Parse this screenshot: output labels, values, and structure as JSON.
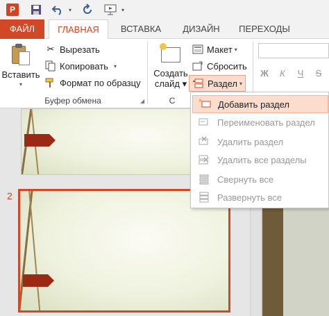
{
  "app": {
    "logo_text": "P",
    "accent_color": "#d24726",
    "icons": [
      "powerpoint-logo-icon",
      "save-icon",
      "undo-icon",
      "redo-icon",
      "slideshow-icon"
    ]
  },
  "tabs": [
    {
      "label": "ФАЙЛ"
    },
    {
      "label": "ГЛАВНАЯ",
      "selected": true
    },
    {
      "label": "ВСТАВКА"
    },
    {
      "label": "ДИЗАЙН"
    },
    {
      "label": "ПЕРЕХОДЫ"
    }
  ],
  "ribbon": {
    "clipboard": {
      "paste_label": "Вставить",
      "cut_label": "Вырезать",
      "copy_label": "Копировать",
      "format_painter_label": "Формат по образцу",
      "group_label": "Буфер обмена"
    },
    "slides": {
      "new_slide_line1": "Создать",
      "new_slide_line2": "слайд",
      "layout_label": "Макет",
      "reset_label": "Сбросить",
      "section_label": "Раздел",
      "group_label": "С"
    },
    "font": {
      "bold": "Ж",
      "italic": "К",
      "underline": "Ч",
      "strike": "S"
    }
  },
  "section_menu": {
    "items": [
      {
        "label": "Добавить раздел",
        "icon": "add-section-icon",
        "enabled": true,
        "highlighted": true
      },
      {
        "label": "Переименовать раздел",
        "icon": "rename-section-icon",
        "enabled": false
      },
      {
        "label": "Удалить раздел",
        "icon": "remove-section-icon",
        "enabled": false
      },
      {
        "label": "Удалить все разделы",
        "icon": "remove-all-sections-icon",
        "enabled": false
      },
      {
        "label": "Свернуть все",
        "icon": "collapse-all-icon",
        "enabled": false
      },
      {
        "label": "Развернуть все",
        "icon": "expand-all-icon",
        "enabled": false
      }
    ]
  },
  "slides": {
    "selected_number": "2"
  }
}
